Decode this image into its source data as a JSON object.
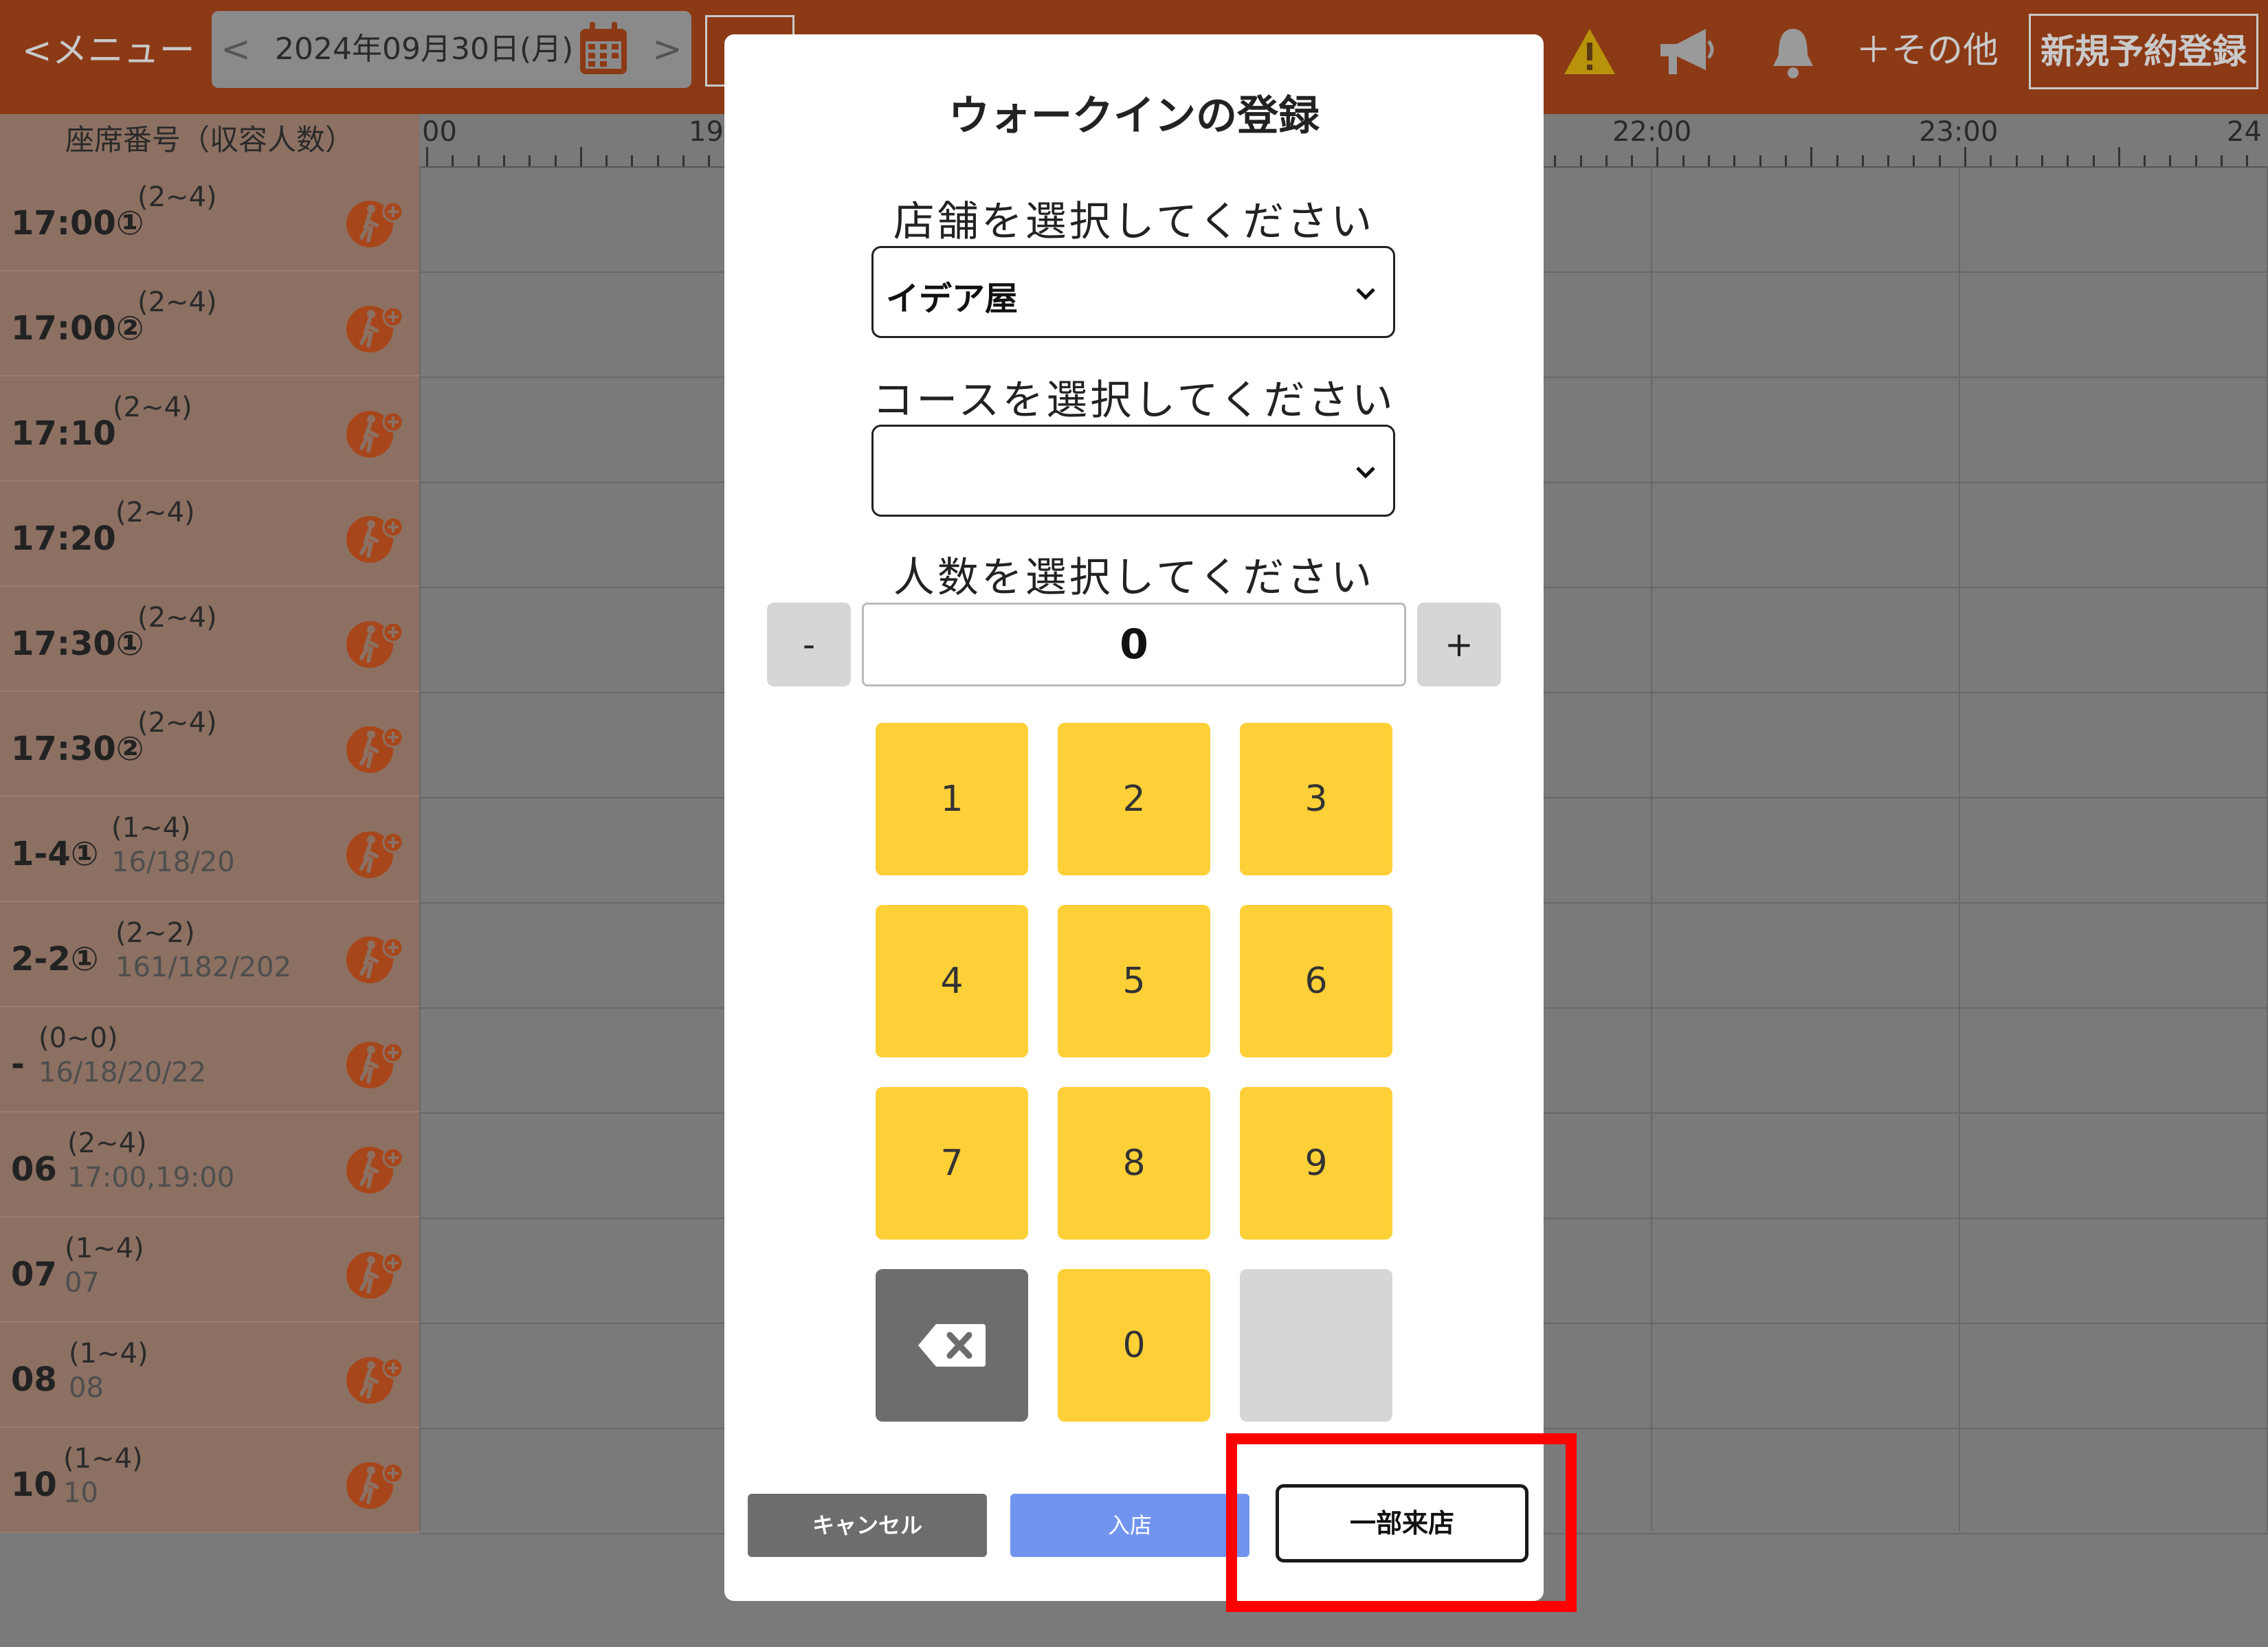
{
  "topbar": {
    "menu_back": "<メニュー",
    "date": "2024年09月30日(月)",
    "prev": "<",
    "next": ">",
    "more": "＋その他",
    "new_reservation": "新規予約登録"
  },
  "timeline": {
    "seat_header": "座席番号（収容人数）",
    "hours": [
      "00",
      "19",
      "22:00",
      "23:00",
      "24"
    ]
  },
  "seats": [
    {
      "name": "17:00①",
      "capacity": "(2~4)",
      "sub": ""
    },
    {
      "name": "17:00②",
      "capacity": "(2~4)",
      "sub": ""
    },
    {
      "name": "17:10",
      "capacity": "(2~4)",
      "sub": ""
    },
    {
      "name": "17:20",
      "capacity": "(2~4)",
      "sub": ""
    },
    {
      "name": "17:30①",
      "capacity": "(2~4)",
      "sub": ""
    },
    {
      "name": "17:30②",
      "capacity": "(2~4)",
      "sub": ""
    },
    {
      "name": "1-4①",
      "capacity": "(1~4)",
      "sub": "16/18/20"
    },
    {
      "name": "2-2①",
      "capacity": "(2~2)",
      "sub": "161/182/202"
    },
    {
      "name": "-",
      "capacity": "(0~0)",
      "sub": "16/18/20/22"
    },
    {
      "name": "06",
      "capacity": "(2~4)",
      "sub": "17:00,19:00"
    },
    {
      "name": "07",
      "capacity": "(1~4)",
      "sub": "07"
    },
    {
      "name": "08",
      "capacity": "(1~4)",
      "sub": "08"
    },
    {
      "name": "10",
      "capacity": "(1~4)",
      "sub": "10"
    }
  ],
  "modal": {
    "title": "ウォークインの登録",
    "store_label": "店舗を選択してください",
    "store_value": "イデア屋",
    "course_label": "コースを選択してください",
    "course_value": "",
    "people_label": "人数を選択してください",
    "minus": "-",
    "plus": "+",
    "count": "0",
    "keys": [
      "1",
      "2",
      "3",
      "4",
      "5",
      "6",
      "7",
      "8",
      "9",
      "0"
    ],
    "cancel": "キャンセル",
    "enter": "入店",
    "partial": "一部来店"
  },
  "colors": {
    "topbar": "#8c3a16",
    "key": "#fdd037",
    "enter_button": "#7194ee",
    "highlight": "#ff0000"
  }
}
